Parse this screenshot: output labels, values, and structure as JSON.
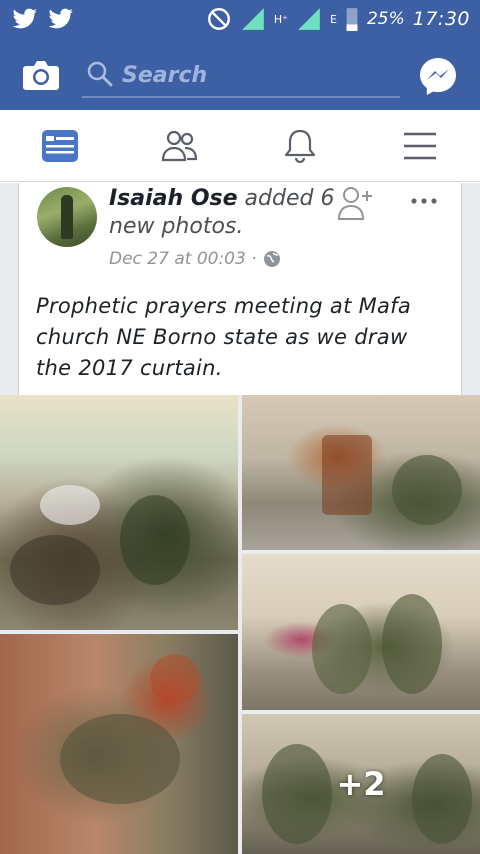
{
  "status_bar": {
    "left_icons": [
      "twitter-icon",
      "twitter-icon"
    ],
    "network_labels": [
      "H⁺",
      "E"
    ],
    "battery": "25%",
    "time": "17:30"
  },
  "topbar": {
    "search_placeholder": "Search"
  },
  "tabs": [
    {
      "name": "home",
      "icon": "news-feed-icon"
    },
    {
      "name": "friends",
      "icon": "friends-icon"
    },
    {
      "name": "notifications",
      "icon": "bell-icon"
    },
    {
      "name": "menu",
      "icon": "menu-icon"
    }
  ],
  "post": {
    "author": "Isaiah Ose",
    "action": " added 6 new photos.",
    "time": "Dec 27 at 00:03 ·",
    "text": "Prophetic prayers meeting at Mafa church NE Borno state as we draw the 2017 curtain.",
    "more_photos_label": "+2"
  },
  "colors": {
    "brand": "#3d5fa3",
    "feed_bg": "#e9ebee"
  }
}
